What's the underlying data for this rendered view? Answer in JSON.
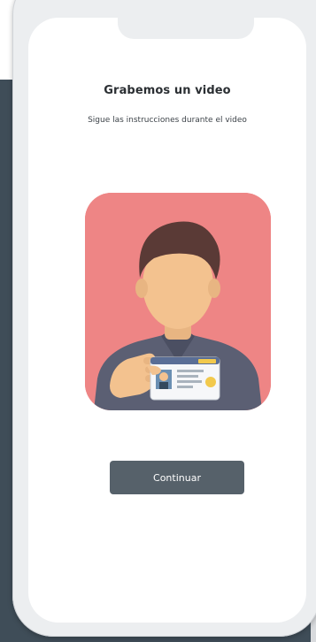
{
  "screen": {
    "title": "Grabemos un video",
    "subtitle": "Sigue las instrucciones durante el video",
    "continue_label": "Continuar"
  },
  "illustration": {
    "icon": "person-holding-id-card-illustration",
    "background_color": "#ee8585"
  },
  "colors": {
    "button_background": "#56616a",
    "page_background": "#3f4d58"
  }
}
